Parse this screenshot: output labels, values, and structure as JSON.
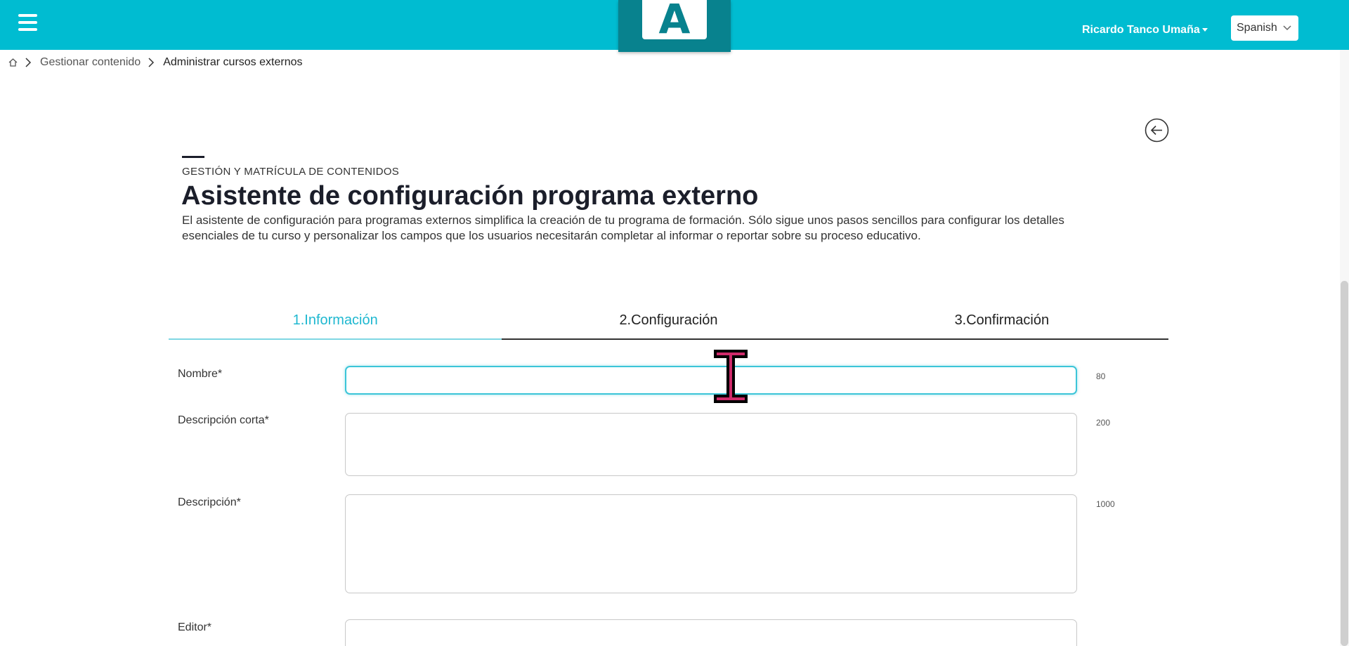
{
  "header": {
    "logo_letter": "A",
    "user_name": "Ricardo Tanco Umaña",
    "language": "Spanish",
    "brand_color": "#00bcd1",
    "logo_tile_color": "#08828e"
  },
  "breadcrumb": {
    "items": [
      "Gestionar contenido",
      "Administrar cursos externos"
    ]
  },
  "page": {
    "section_label": "GESTIÓN Y MATRÍCULA DE CONTENIDOS",
    "title": "Asistente de configuración programa externo",
    "description": "El asistente de configuración para programas externos simplifica la creación de tu programa de formación. Sólo sigue unos pasos sencillos para configurar los detalles esenciales de tu curso y personalizar los campos que los usuarios necesitarán completar al informar o reportar sobre su proceso educativo."
  },
  "steps": [
    {
      "label": "1.Información",
      "active": true
    },
    {
      "label": "2.Configuración",
      "active": false
    },
    {
      "label": "3.Confirmación",
      "active": false
    }
  ],
  "form": {
    "nombre": {
      "label": "Nombre*",
      "value": "",
      "max": "80"
    },
    "descripcion_corta": {
      "label": "Descripción corta*",
      "value": "",
      "max": "200"
    },
    "descripcion": {
      "label": "Descripción*",
      "value": "",
      "max": "1000"
    },
    "editor": {
      "label": "Editor*",
      "value": ""
    }
  },
  "icons": [
    "menu-icon",
    "home-icon",
    "chevron-right-icon",
    "chevron-down-icon",
    "arrow-left-icon",
    "text-cursor-icon"
  ]
}
